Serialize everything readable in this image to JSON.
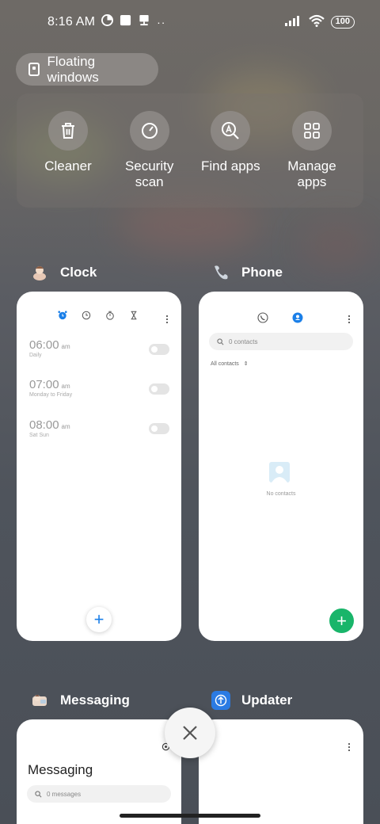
{
  "status_bar": {
    "time": "8:16 AM",
    "battery": "100"
  },
  "floating_windows": {
    "label": "Floating windows"
  },
  "quick_actions": [
    {
      "label": "Cleaner",
      "icon": "trash-icon"
    },
    {
      "label": "Security scan",
      "icon": "speedometer-icon"
    },
    {
      "label": "Find apps",
      "icon": "find-apps-icon"
    },
    {
      "label": "Manage apps",
      "icon": "grid-icon"
    }
  ],
  "apps": {
    "clock": {
      "name": "Clock",
      "alarms": [
        {
          "time": "06:00",
          "ampm": "am",
          "days": "Daily"
        },
        {
          "time": "07:00",
          "ampm": "am",
          "days": "Monday to Friday"
        },
        {
          "time": "08:00",
          "ampm": "am",
          "days": "Sat Sun"
        }
      ]
    },
    "phone": {
      "name": "Phone",
      "search_placeholder": "0 contacts",
      "filter": "All contacts",
      "empty_text": "No contacts"
    },
    "messaging": {
      "name": "Messaging",
      "title": "Messaging",
      "search_placeholder": "0 messages"
    },
    "updater": {
      "name": "Updater"
    }
  },
  "colors": {
    "accent_blue": "#1a7fe8",
    "fab_green": "#19b56a"
  }
}
